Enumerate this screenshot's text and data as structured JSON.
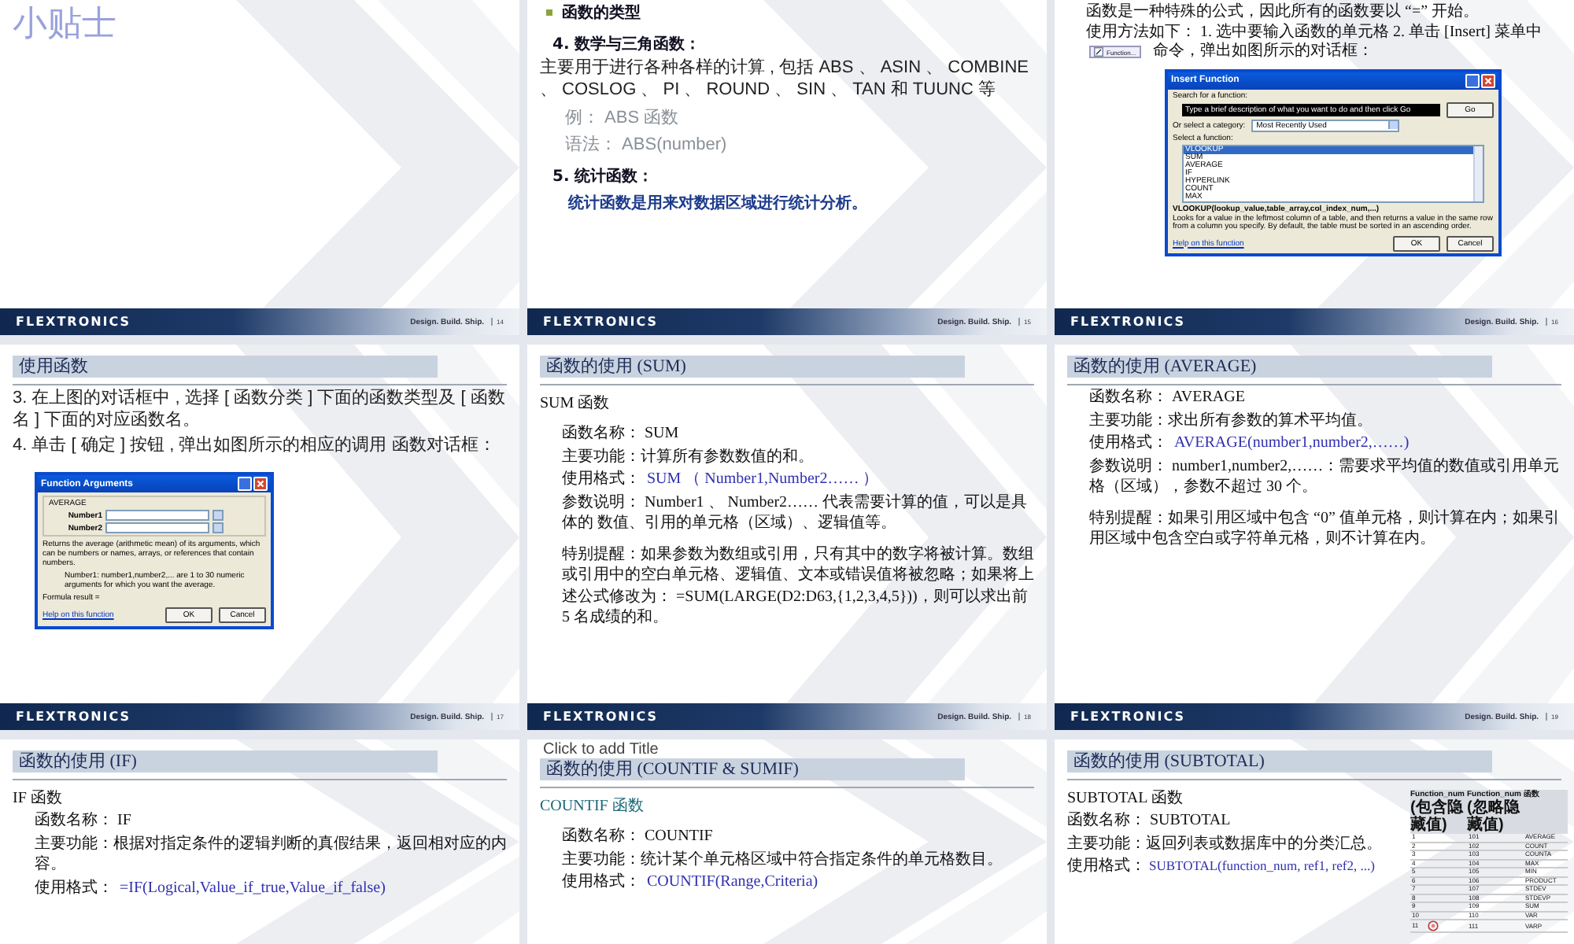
{
  "slides": [
    {
      "footer": {
        "brand": "FLEXTRONICS",
        "tagline": "Design. Build. Ship.",
        "number": "14"
      },
      "blocks": [
        {
          "kind": "big-title",
          "text": "小贴士"
        }
      ]
    },
    {
      "footer": {
        "brand": "FLEXTRONICS",
        "tagline": "Design. Build. Ship.",
        "number": "15"
      },
      "blocks": [
        {
          "kind": "bullet",
          "text": "函数的类型"
        },
        {
          "kind": "label",
          "text": "4. 数学与三角函数："
        },
        {
          "kind": "sans-para",
          "text": "主要用于进行各种各样的计算 , 包括 ABS 、 ASIN 、 COMBINE 、 COSLOG 、 PI 、 ROUND 、 SIN 、 TAN 和 TUUNC 等"
        },
        {
          "kind": "note",
          "text": "例： ABS 函数"
        },
        {
          "kind": "note",
          "text": "语法： ABS(number)"
        },
        {
          "kind": "label",
          "text": "5. 统计函数："
        },
        {
          "kind": "accent",
          "text": "统计函数是用来对数据区域进行统计分析。"
        }
      ]
    },
    {
      "footer": {
        "brand": "FLEXTRONICS",
        "tagline": "Design. Build. Ship.",
        "number": "16"
      },
      "blocks": [
        {
          "kind": "para",
          "text": "函数是一种特殊的公式，因此所有的函数要以 “=” 开始。"
        },
        {
          "kind": "para-badge",
          "text": "使用方法如下： 1. 选中要输入函数的单元格 2. 单击 [Insert] 菜单中",
          "badge": "Function...",
          "tail": "命令，弹出如图所示的对话框："
        },
        {
          "kind": "dialog-insert",
          "title": "Insert Function",
          "search_label": "Search for a function:",
          "search_text": "Type a brief description of what you want to do and then click Go",
          "go": "Go",
          "category_label": "Or select a category:",
          "category": "Most Recently Used",
          "list_label": "Select a function:",
          "items": [
            {
              "label": "VLOOKUP",
              "selected": true
            },
            {
              "label": "SUM",
              "selected": false
            },
            {
              "label": "AVERAGE",
              "selected": false
            },
            {
              "label": "IF",
              "selected": false
            },
            {
              "label": "HYPERLINK",
              "selected": false
            },
            {
              "label": "COUNT",
              "selected": false
            },
            {
              "label": "MAX",
              "selected": false
            }
          ],
          "signature": "VLOOKUP(lookup_value,table_array,col_index_num,...)",
          "description": "Looks for a value in the leftmost column of a table, and then returns a value in the same row from a column you specify. By default, the table must be sorted in an ascending order.",
          "help": "Help on this function",
          "ok": "OK",
          "cancel": "Cancel"
        }
      ]
    },
    {
      "footer": {
        "brand": "FLEXTRONICS",
        "tagline": "Design. Build. Ship.",
        "number": "17"
      },
      "blocks": [
        {
          "kind": "title-bar",
          "text": "使用函数"
        },
        {
          "kind": "sans-para",
          "text": "3. 在上图的对话框中 , 选择 [ 函数分类 ] 下面的函数类型及 [ 函数名 ] 下面的对应函数名。"
        },
        {
          "kind": "sans-para",
          "text": "4. 单击 [ 确定 ] 按钮 , 弹出如图所示的相应的调用 函数对话框："
        },
        {
          "kind": "dialog-args",
          "title": "Function Arguments",
          "function": "AVERAGE",
          "args": [
            "Number1",
            "Number2"
          ],
          "description": "Returns the average (arithmetic mean) of its arguments, which can be numbers or names, arrays, or references that contain numbers.",
          "arg_help": "Number1: number1,number2,... are 1 to 30 numeric arguments for which you want the average.",
          "result": "Formula result =",
          "help": "Help on this function",
          "ok": "OK",
          "cancel": "Cancel"
        }
      ]
    },
    {
      "footer": {
        "brand": "FLEXTRONICS",
        "tagline": "Design. Build. Ship.",
        "number": "18"
      },
      "blocks": [
        {
          "kind": "title-bar",
          "text": "函数的使用 (SUM)"
        },
        {
          "kind": "heading",
          "text": "SUM 函数"
        },
        {
          "kind": "spaced-para",
          "text": "函数名称： SUM"
        },
        {
          "kind": "indent-para",
          "text": "主要功能：计算所有参数数值的和。"
        },
        {
          "kind": "format",
          "label": "使用格式：",
          "code": "SUM （ Number1,Number2…… ）"
        },
        {
          "kind": "indent-para",
          "text": "参数说明： Number1 、 Number2…… 代表需要计算的值，可以是具体的 数值、引用的单元格（区域）、逻辑值等。"
        },
        {
          "kind": "spaced-para",
          "text": "特别提醒：如果参数为数组或引用，只有其中的数字将被计算。数组或引用中的空白单元格、逻辑值、文本或错误值将被忽略；如果将上述公式修改为： =SUM(LARGE(D2:D63,{1,2,3,4,5}))，则可以求出前 5 名成绩的和。"
        }
      ]
    },
    {
      "footer": {
        "brand": "FLEXTRONICS",
        "tagline": "Design. Build. Ship.",
        "number": "19"
      },
      "blocks": [
        {
          "kind": "title-bar",
          "text": "函数的使用 (AVERAGE)"
        },
        {
          "kind": "indent-para",
          "text": "函数名称： AVERAGE"
        },
        {
          "kind": "indent-para",
          "text": "主要功能：求出所有参数的算术平均值。"
        },
        {
          "kind": "format",
          "label": "使用格式：",
          "code": "AVERAGE(number1,number2,……)"
        },
        {
          "kind": "indent-para",
          "text": "参数说明： number1,number2,……：需要求平均值的数值或引用单元格（区域），参数不超过 30 个。"
        },
        {
          "kind": "spaced-para",
          "text": "特别提醒：如果引用区域中包含 “0” 值单元格，则计算在内；如果引用区域中包含空白或字符单元格，则不计算在内。"
        }
      ]
    },
    {
      "blocks": [
        {
          "kind": "title-bar",
          "text": "函数的使用 (IF)"
        },
        {
          "kind": "heading",
          "text": "IF 函数"
        },
        {
          "kind": "indent-para",
          "text": "函数名称： IF"
        },
        {
          "kind": "indent-para",
          "text": "主要功能：根据对指定条件的逻辑判断的真假结果，返回相对应的内容。"
        },
        {
          "kind": "format",
          "label": "使用格式：",
          "code": "=IF(Logical,Value_if_true,Value_if_false)"
        }
      ]
    },
    {
      "blocks": [
        {
          "kind": "title-bar",
          "text": "函数的使用 (COUNTIF & SUMIF)",
          "overlay": "Click to add Title"
        },
        {
          "kind": "teal-heading",
          "text": "COUNTIF 函数"
        },
        {
          "kind": "spaced-para",
          "text": "函数名称： COUNTIF"
        },
        {
          "kind": "indent-para",
          "text": "主要功能：统计某个单元格区域中符合指定条件的单元格数目。"
        },
        {
          "kind": "format",
          "label": "使用格式：",
          "code": "COUNTIF(Range,Criteria)"
        }
      ]
    },
    {
      "blocks": [
        {
          "kind": "title-bar",
          "text": "函数的使用 (SUBTOTAL)"
        },
        {
          "kind": "columns",
          "left": [
            {
              "kind": "heading",
              "text": "SUBTOTAL 函数"
            },
            {
              "kind": "indent-para",
              "text": "函数名称： SUBTOTAL"
            },
            {
              "kind": "indent-para",
              "text": "主要功能：返回列表或数据库中的分类汇总。"
            },
            {
              "kind": "format",
              "label": "使用格式：",
              "code": "SUBTOTAL(function_num, ref1, ref2, ...)"
            }
          ],
          "right": [
            {
              "kind": "table",
              "columns": [
                {
                  "name": "Function_num",
                  "note": "(包含隐藏值)"
                },
                {
                  "name": "Function_num",
                  "note": "(忽略隐藏值)"
                },
                {
                  "name": "函数"
                }
              ],
              "rows": [
                {
                  "kind": "plain",
                  "cells": [
                    "1",
                    "101",
                    "AVERAGE"
                  ]
                },
                {
                  "kind": "plain",
                  "cells": [
                    "2",
                    "102",
                    "COUNT"
                  ]
                },
                {
                  "kind": "plain",
                  "cells": [
                    "3",
                    "103",
                    "COUNTA"
                  ]
                },
                {
                  "kind": "plain",
                  "cells": [
                    "4",
                    "104",
                    "MAX"
                  ]
                },
                {
                  "kind": "plain",
                  "cells": [
                    "5",
                    "105",
                    "MIN"
                  ]
                },
                {
                  "kind": "plain",
                  "cells": [
                    "6",
                    "106",
                    "PRODUCT"
                  ]
                },
                {
                  "kind": "plain",
                  "cells": [
                    "7",
                    "107",
                    "STDEV"
                  ]
                },
                {
                  "kind": "plain",
                  "cells": [
                    "8",
                    "108",
                    "STDEVP"
                  ]
                },
                {
                  "kind": "plain",
                  "cells": [
                    "9",
                    "109",
                    "SUM"
                  ]
                },
                {
                  "kind": "plain",
                  "cells": [
                    "10",
                    "110",
                    "VAR"
                  ]
                },
                {
                  "kind": "stamped",
                  "cells": [
                    "11",
                    "111",
                    "VARP"
                  ]
                }
              ]
            }
          ]
        }
      ]
    }
  ]
}
